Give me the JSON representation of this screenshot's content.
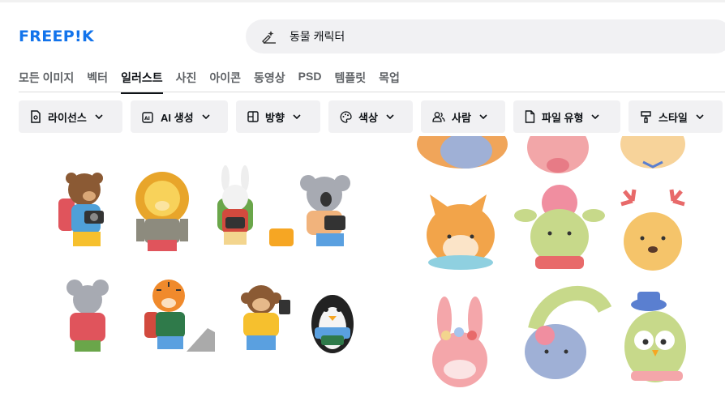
{
  "brand": {
    "logo": "FREEP!K",
    "color": "#1273eb"
  },
  "search": {
    "value": "동물 캐릭터",
    "icon": "ai-search-icon"
  },
  "tabs": [
    {
      "label": "모든 이미지",
      "active": false
    },
    {
      "label": "벡터",
      "active": false
    },
    {
      "label": "일러스트",
      "active": true
    },
    {
      "label": "사진",
      "active": false
    },
    {
      "label": "아이콘",
      "active": false
    },
    {
      "label": "동영상",
      "active": false
    },
    {
      "label": "PSD",
      "active": false
    },
    {
      "label": "템플릿",
      "active": false
    },
    {
      "label": "목업",
      "active": false
    }
  ],
  "filters": [
    {
      "label": "라이선스",
      "icon": "license-icon"
    },
    {
      "label": "AI 생성",
      "icon": "ai-generated-icon"
    },
    {
      "label": "방향",
      "icon": "orientation-icon"
    },
    {
      "label": "색상",
      "icon": "palette-icon"
    },
    {
      "label": "사람",
      "icon": "people-icon"
    },
    {
      "label": "파일 유형",
      "icon": "file-icon"
    },
    {
      "label": "스타일",
      "icon": "style-brush-icon"
    }
  ],
  "results": [
    {
      "name": "travelling-animals-illustration"
    },
    {
      "name": "animal-heads-illustration"
    }
  ]
}
